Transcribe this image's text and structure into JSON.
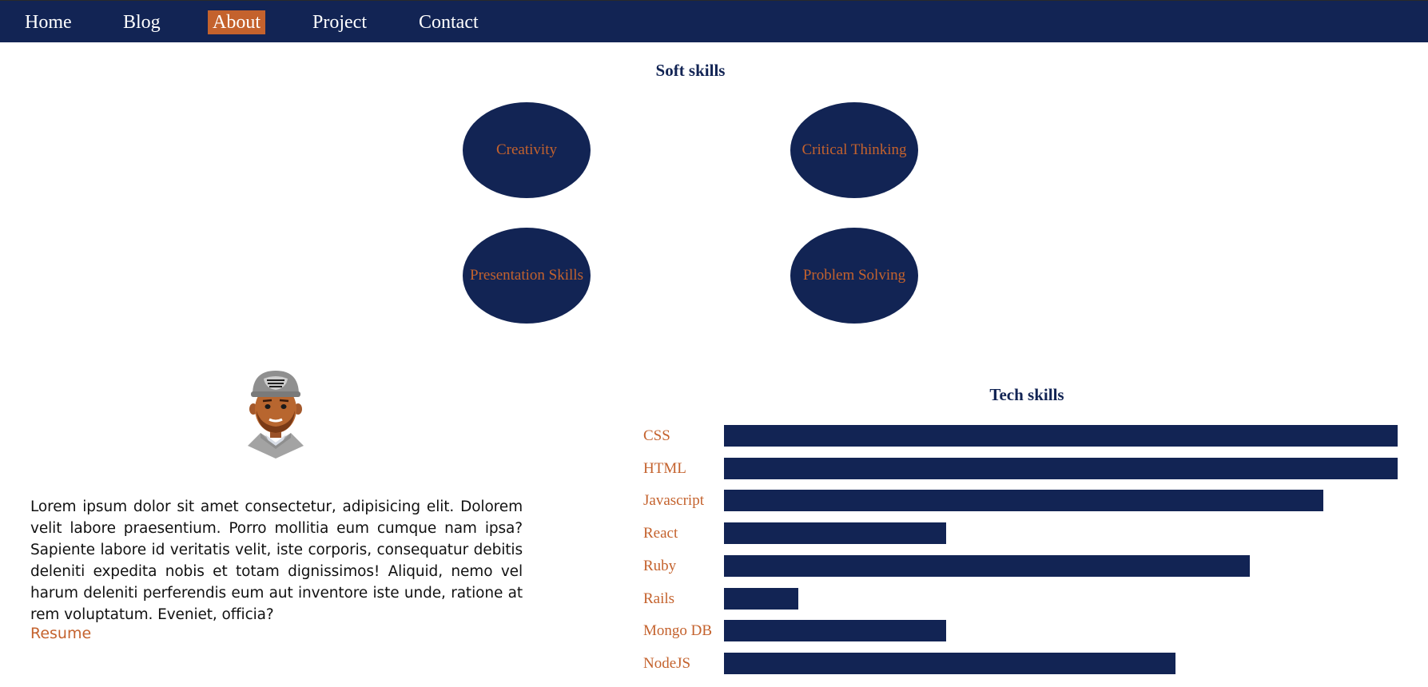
{
  "nav": {
    "items": [
      {
        "label": "Home"
      },
      {
        "label": "Blog"
      },
      {
        "label": "About",
        "active": true
      },
      {
        "label": "Project"
      },
      {
        "label": "Contact"
      }
    ]
  },
  "soft_skills": {
    "title": "Soft skills",
    "items": [
      "Creativity",
      "Critical Thinking",
      "Presentation Skills",
      "Problem Solving"
    ]
  },
  "about": {
    "avatar_icon": "avatar-cap-icon",
    "text": "Lorem ipsum dolor sit amet consectetur, adipisicing elit. Dolorem velit labore praesentium. Porro mollitia eum cumque nam ipsa? Sapiente labore id veritatis velit, iste corporis, consequatur debitis deleniti expedita nobis et totam dignissimos! Aliquid, nemo vel harum deleniti perferendis eum aut inventore iste unde, ratione at rem voluptatum. Eveniet, officia?",
    "resume_label": "Resume"
  },
  "tech_skills": {
    "title": "Tech skills",
    "items": [
      {
        "label": "CSS",
        "level": 1.0
      },
      {
        "label": "HTML",
        "level": 1.0
      },
      {
        "label": "Javascript",
        "level": 0.89
      },
      {
        "label": "React",
        "level": 0.33
      },
      {
        "label": "Ruby",
        "level": 0.78
      },
      {
        "label": "Rails",
        "level": 0.11
      },
      {
        "label": "Mongo DB",
        "level": 0.33
      },
      {
        "label": "NodeJS",
        "level": 0.67
      }
    ]
  },
  "colors": {
    "navy": "#122454",
    "accent": "#c4622d"
  }
}
